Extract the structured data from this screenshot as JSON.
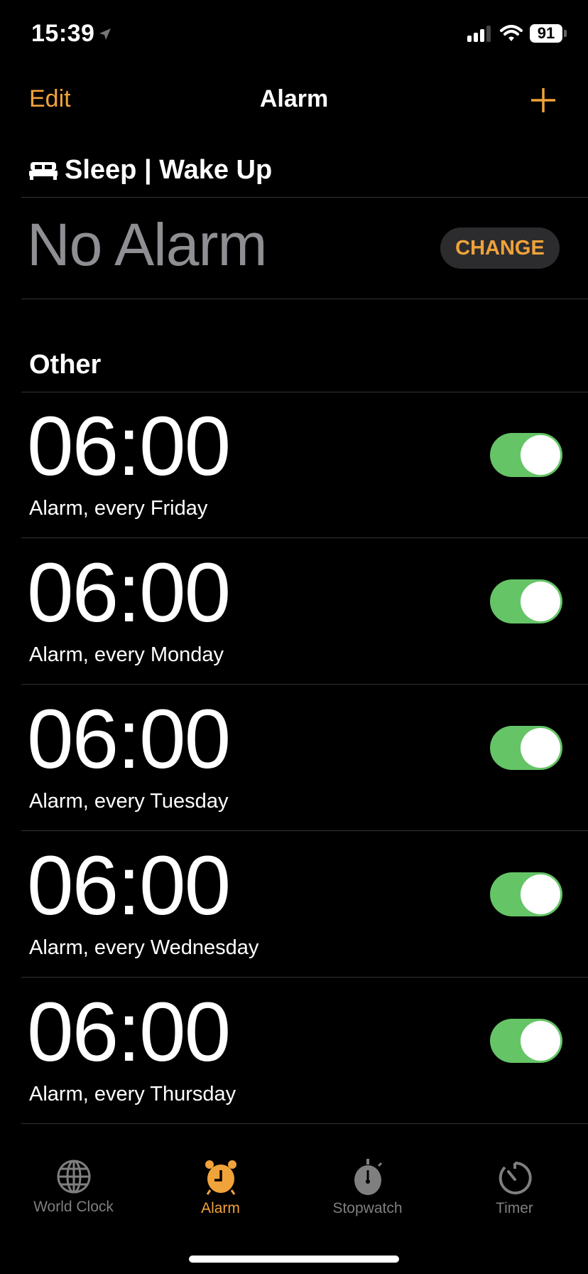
{
  "status_bar": {
    "time": "15:39",
    "battery": "91",
    "location_icon": "location-arrow-icon",
    "signal_icon": "cellular-signal-icon",
    "wifi_icon": "wifi-icon"
  },
  "nav": {
    "edit_label": "Edit",
    "title": "Alarm",
    "add_icon": "plus-icon"
  },
  "sleep": {
    "header": "Sleep | Wake Up",
    "icon": "bed-icon",
    "status": "No Alarm",
    "change_label": "CHANGE"
  },
  "other": {
    "header": "Other",
    "alarms": [
      {
        "time": "06:00",
        "label": "Alarm, every Friday",
        "enabled": true
      },
      {
        "time": "06:00",
        "label": "Alarm, every Monday",
        "enabled": true
      },
      {
        "time": "06:00",
        "label": "Alarm, every Tuesday",
        "enabled": true
      },
      {
        "time": "06:00",
        "label": "Alarm, every Wednesday",
        "enabled": true
      },
      {
        "time": "06:00",
        "label": "Alarm, every Thursday",
        "enabled": true
      }
    ]
  },
  "tabs": [
    {
      "label": "World Clock",
      "icon": "globe-icon",
      "active": false
    },
    {
      "label": "Alarm",
      "icon": "alarm-clock-icon",
      "active": true
    },
    {
      "label": "Stopwatch",
      "icon": "stopwatch-icon",
      "active": false
    },
    {
      "label": "Timer",
      "icon": "timer-icon",
      "active": false
    }
  ],
  "colors": {
    "accent": "#f0a33a",
    "toggle_on": "#65c466",
    "background": "#000000",
    "secondary_text": "#8e8e93"
  }
}
